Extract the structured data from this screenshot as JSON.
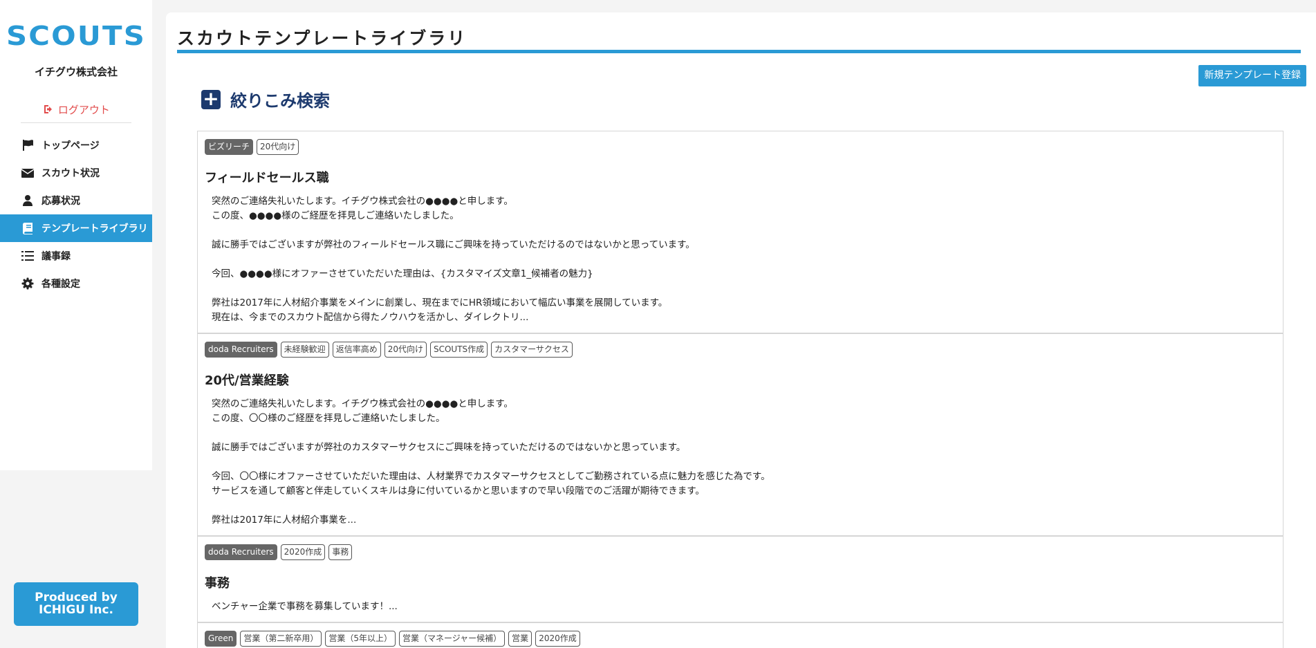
{
  "sidebar": {
    "logo": "SCOUTS",
    "company": "イチグウ株式会社",
    "logout": "ログアウト",
    "items": [
      {
        "label": "トップページ",
        "icon": "flag-icon"
      },
      {
        "label": "スカウト状況",
        "icon": "envelope-icon"
      },
      {
        "label": "応募状況",
        "icon": "user-icon"
      },
      {
        "label": "テンプレートライブラリ",
        "icon": "book-icon"
      },
      {
        "label": "議事録",
        "icon": "list-icon"
      },
      {
        "label": "各種設定",
        "icon": "gear-icon"
      }
    ],
    "produced_line1": "Produced by",
    "produced_line2": "ICHIGU Inc."
  },
  "main": {
    "title": "スカウトテンプレートライブラリ",
    "new_button": "新規テンプレート登録",
    "filter_label": "絞りこみ検索",
    "templates": [
      {
        "tags": [
          "ビズリーチ",
          "20代向け"
        ],
        "title": "フィールドセールス職",
        "body": "突然のご連絡失礼いたします。イチグウ株式会社の●●●●と申します。\nこの度、●●●●様のご経歴を拝見しご連絡いたしました。\n\n誠に勝手ではございますが弊社のフィールドセールス職にご興味を持っていただけるのではないかと思っています。\n\n今回、●●●●様にオファーさせていただいた理由は、{カスタマイズ文章1_候補者の魅力}\n\n弊社は2017年に人材紹介事業をメインに創業し、現在までにHR領域において幅広い事業を展開しています。\n現在は、今までのスカウト配信から得たノウハウを活かし、ダイレクトリ..."
      },
      {
        "tags": [
          "doda Recruiters",
          "未経験歓迎",
          "返信率高め",
          "20代向け",
          "SCOUTS作成",
          "カスタマーサクセス"
        ],
        "title": "20代/営業経験",
        "body": "突然のご連絡失礼いたします。イチグウ株式会社の●●●●と申します。\nこの度、〇〇様のご経歴を拝見しご連絡いたしました。\n\n誠に勝手ではございますが弊社のカスタマーサクセスにご興味を持っていただけるのではないかと思っています。\n\n今回、〇〇様にオファーさせていただいた理由は、人材業界でカスタマーサクセスとしてご勤務されている点に魅力を感じた為です。\nサービスを通して顧客と伴走していくスキルは身に付いているかと思いますので早い段階でのご活躍が期待できます。\n\n弊社は2017年に人材紹介事業を..."
      },
      {
        "tags": [
          "doda Recruiters",
          "2020作成",
          "事務"
        ],
        "title": "事務",
        "body": "ベンチャー企業で事務を募集しています！..."
      },
      {
        "tags": [
          "Green",
          "営業（第二新卒用）",
          "営業（5年以上）",
          "営業（マネージャー候補）",
          "営業",
          "2020作成"
        ],
        "title": "",
        "body": ""
      }
    ]
  }
}
